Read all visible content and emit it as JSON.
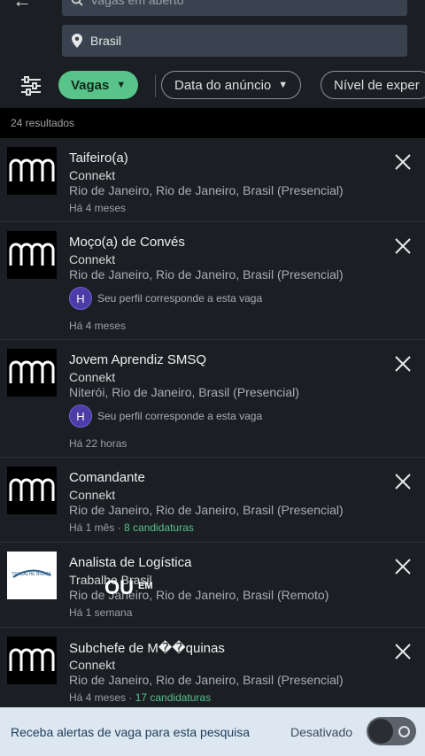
{
  "search": {
    "keyword": "Vagas em aberto",
    "location": "Brasil"
  },
  "filters": {
    "active": "Vagas",
    "date": "Data do anúncio",
    "level": "Nível de exper"
  },
  "results_count": "24 resultados",
  "jobs": [
    {
      "title": "Taifeiro(a)",
      "company": "Connekt",
      "location": "Rio de Janeiro, Rio de Janeiro, Brasil (Presencial)",
      "posted": "Há 4 meses"
    },
    {
      "title": "Moço(a) de Convés",
      "company": "Connekt",
      "location": "Rio de Janeiro, Rio de Janeiro, Brasil (Presencial)",
      "match_initial": "H",
      "match": "Seu perfil corresponde a esta vaga",
      "posted": "Há 4 meses"
    },
    {
      "title": "Jovem Aprendiz SMSQ",
      "company": "Connekt",
      "location": "Niterói, Rio de Janeiro, Brasil (Presencial)",
      "match_initial": "H",
      "match": "Seu perfil corresponde a esta vaga",
      "posted": "Há 22 horas"
    },
    {
      "title": "Comandante",
      "company": "Connekt",
      "location": "Rio de Janeiro, Rio de Janeiro, Brasil (Presencial)",
      "posted": "Há 1 mês",
      "sep": " · ",
      "applications": "8 candidaturas"
    },
    {
      "title": "Analista de Logística",
      "company": "Trabalhe Brasil",
      "location": "Rio de Janeiro, Rio de Janeiro, Brasil (Remoto)",
      "posted": "Há 1 semana",
      "logo_text": "TRABALHE BRASIL"
    },
    {
      "title": "Subchefe de M��quinas",
      "company": "Connekt",
      "location": "Rio de Janeiro, Rio de Janeiro, Brasil (Presencial)",
      "posted": "Há 4 meses",
      "sep": " · ",
      "applications": "17 candidaturas"
    }
  ],
  "overlay": {
    "main": "OU",
    "sup": "EM"
  },
  "alert": {
    "text": "Receba alertas de vaga para esta pesquisa",
    "status": "Desativado"
  }
}
